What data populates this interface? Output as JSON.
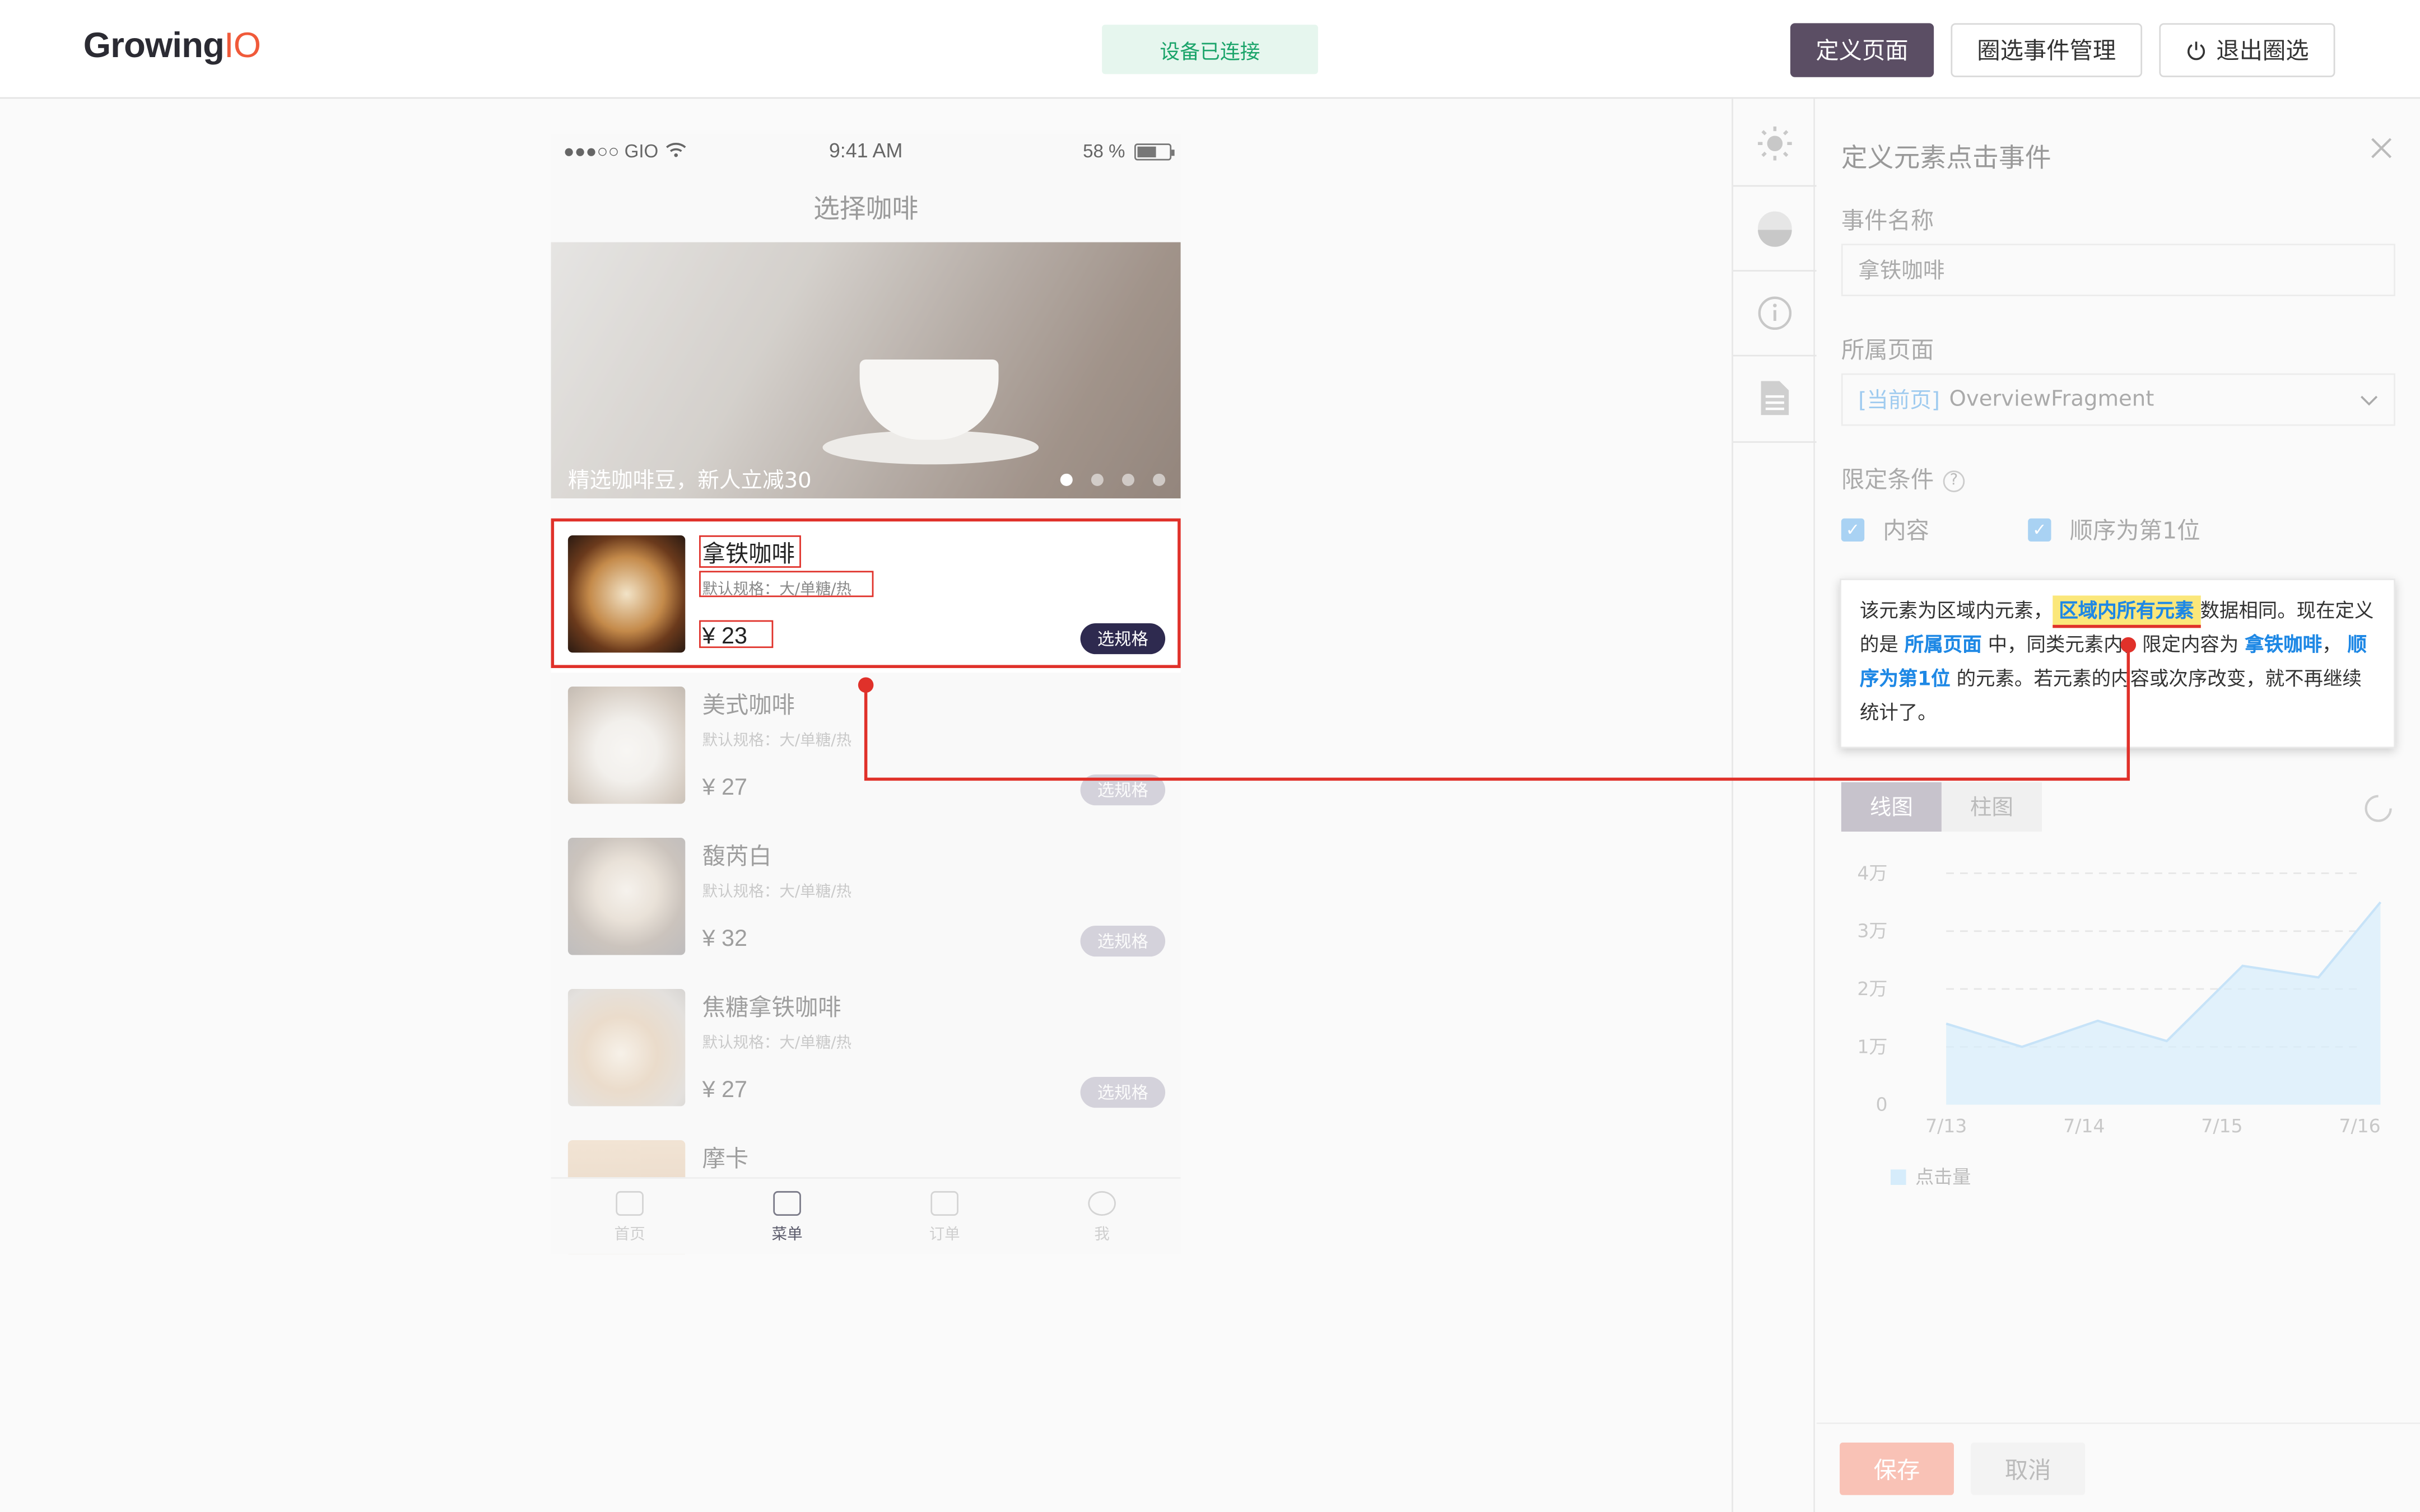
{
  "header": {
    "logo_main": "Growing",
    "logo_accent": "IO",
    "device_status": "设备已连接",
    "define_page_label": "定义页面",
    "event_manage_label": "圈选事件管理",
    "exit_label": "退出圈选"
  },
  "phone": {
    "carrier": "●●●○○ GIO",
    "time": "9:41 AM",
    "battery": "58 %",
    "nav_title": "选择咖啡",
    "banner_caption": "精选咖啡豆，新人立减30",
    "items": [
      {
        "name": "拿铁咖啡",
        "spec": "默认规格：大/单糖/热",
        "price": "¥ 23",
        "button": "选规格"
      },
      {
        "name": "美式咖啡",
        "spec": "默认规格：大/单糖/热",
        "price": "¥ 27",
        "button": "选规格"
      },
      {
        "name": "馥芮白",
        "spec": "默认规格：大/单糖/热",
        "price": "¥ 32",
        "button": "选规格"
      },
      {
        "name": "焦糖拿铁咖啡",
        "spec": "默认规格：大/单糖/热",
        "price": "¥ 27",
        "button": "选规格"
      },
      {
        "name": "摩卡"
      }
    ],
    "tabs": [
      "首页",
      "菜单",
      "订单",
      "我"
    ]
  },
  "panel": {
    "title": "定义元素点击事件",
    "event_name_label": "事件名称",
    "event_name_value": "拿铁咖啡",
    "page_label": "所属页面",
    "page_current_tag": "[当前页]",
    "page_value": "OverviewFragment",
    "condition_label": "限定条件",
    "help_glyph": "?",
    "cond_content": "内容",
    "cond_order": "顺序为第1位",
    "tip": {
      "p1": "该元素为区域内元素，",
      "hi": "区域内所有元素",
      "p2": "数据相同。现在定义的是",
      "b1": "所属页面",
      "p3": "中，同类元素内，限定内容为",
      "b2": "拿铁咖啡",
      "p4": "，",
      "b3": "顺序为第1位",
      "p5": "的元素。若元素的内容或次序改变，就不再继续统计了。"
    },
    "tab_line": "线图",
    "tab_bar": "柱图",
    "save": "保存",
    "cancel": "取消"
  },
  "chart_data": {
    "type": "area",
    "categories": [
      "7/13",
      "7/14",
      "7/15",
      "7/16"
    ],
    "y_ticks": [
      "0",
      "1万",
      "2万",
      "3万",
      "4万"
    ],
    "ylim": [
      0,
      40000
    ],
    "series": [
      {
        "name": "点击量",
        "x": [
          0,
          0.55,
          1.1,
          1.6,
          2.15,
          2.7,
          3.15
        ],
        "values": [
          14000,
          10000,
          14500,
          11000,
          24000,
          22000,
          35000
        ]
      }
    ],
    "grid": true,
    "legend": "bottom-left",
    "color": "#d6ecfb"
  }
}
